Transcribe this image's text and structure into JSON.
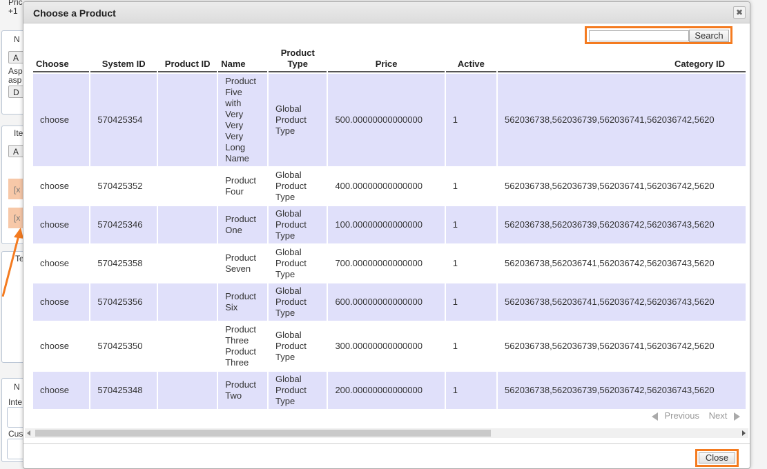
{
  "background": {
    "labels": [
      "Pric",
      "+1",
      "N",
      "A",
      "Asp",
      "asp",
      "D",
      "Ite",
      "A",
      "[x",
      "[x",
      "Te",
      "N",
      "Inte",
      "Cus"
    ]
  },
  "dialog": {
    "title": "Choose a Product",
    "close_icon": "✖",
    "search": {
      "placeholder": "",
      "value": "",
      "button_label": "Search"
    },
    "columns": [
      "Choose",
      "System ID",
      "Product ID",
      "Name",
      "Product Type",
      "Price",
      "Active",
      "Category ID"
    ],
    "rows": [
      {
        "choose": "choose",
        "system_id": "570425354",
        "product_id": "",
        "name": "Product Five with Very Very Very Long Name",
        "type": "Global Product Type",
        "price": "500.00000000000000",
        "active": "1",
        "category_ids": "562036738,562036739,562036741,562036742,5620"
      },
      {
        "choose": "choose",
        "system_id": "570425352",
        "product_id": "",
        "name": "Product Four",
        "type": "Global Product Type",
        "price": "400.00000000000000",
        "active": "1",
        "category_ids": "562036738,562036739,562036741,562036742,5620"
      },
      {
        "choose": "choose",
        "system_id": "570425346",
        "product_id": "",
        "name": "Product One",
        "type": "Global Product Type",
        "price": "100.00000000000000",
        "active": "1",
        "category_ids": "562036738,562036739,562036742,562036743,5620"
      },
      {
        "choose": "choose",
        "system_id": "570425358",
        "product_id": "",
        "name": "Product Seven",
        "type": "Global Product Type",
        "price": "700.00000000000000",
        "active": "1",
        "category_ids": "562036738,562036741,562036742,562036743,5620"
      },
      {
        "choose": "choose",
        "system_id": "570425356",
        "product_id": "",
        "name": "Product Six",
        "type": "Global Product Type",
        "price": "600.00000000000000",
        "active": "1",
        "category_ids": "562036738,562036741,562036742,562036743,5620"
      },
      {
        "choose": "choose",
        "system_id": "570425350",
        "product_id": "",
        "name": "Product Three Product Three",
        "type": "Global Product Type",
        "price": "300.00000000000000",
        "active": "1",
        "category_ids": "562036738,562036739,562036741,562036742,5620"
      },
      {
        "choose": "choose",
        "system_id": "570425348",
        "product_id": "",
        "name": "Product Two",
        "type": "Global Product Type",
        "price": "200.00000000000000",
        "active": "1",
        "category_ids": "562036738,562036739,562036742,562036743,5620"
      }
    ],
    "pager": {
      "previous": "Previous",
      "next": "Next"
    },
    "close_button": "Close"
  },
  "colors": {
    "highlight_outline": "#f47b20",
    "row_alt": "#e0e0fa"
  }
}
